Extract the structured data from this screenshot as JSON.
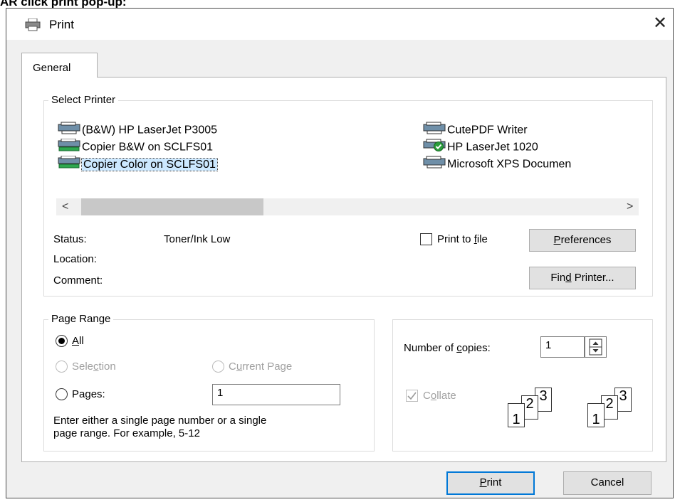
{
  "caption": "AR click print pop-up:",
  "dialog": {
    "title": "Print",
    "tab": "General",
    "select_printer": {
      "label": "Select Printer",
      "printers_left": [
        {
          "name": "(B&W) HP LaserJet P3005",
          "icon": "printer-icon"
        },
        {
          "name": "Copier B&W on SCLFS01",
          "icon": "network-printer-icon"
        },
        {
          "name": "Copier Color on SCLFS01",
          "icon": "network-printer-icon",
          "selected": true
        }
      ],
      "printers_right": [
        {
          "name": "CutePDF Writer",
          "icon": "printer-icon"
        },
        {
          "name": "HP LaserJet 1020",
          "icon": "default-printer-icon"
        },
        {
          "name": "Microsoft XPS Documen",
          "icon": "printer-icon"
        }
      ],
      "scroll_left": "<",
      "scroll_right": ">",
      "status_label": "Status:",
      "status_value": "Toner/Ink Low",
      "location_label": "Location:",
      "comment_label": "Comment:",
      "print_to_file_pre": "Print to ",
      "print_to_file_key": "f",
      "print_to_file_post": "ile",
      "preferences_key": "P",
      "preferences_rest": "references",
      "find_printer_pre": "Fin",
      "find_printer_key": "d",
      "find_printer_post": " Printer..."
    },
    "page_range": {
      "label": "Page Range",
      "all_key": "A",
      "all_rest": "ll",
      "selection_pre": "Sele",
      "selection_key": "c",
      "selection_post": "tion",
      "current_page_pre": "C",
      "current_page_key": "u",
      "current_page_post": "rrent Page",
      "pages_pre": "Pa",
      "pages_key": "g",
      "pages_post": "es:",
      "pages_value": "1",
      "hint_line1": "Enter either a single page number or a single",
      "hint_line2": "page range.  For example, 5-12"
    },
    "copies": {
      "label_pre": "Number of ",
      "label_key": "c",
      "label_post": "opies:",
      "value": "1",
      "collate_pre": "C",
      "collate_key": "o",
      "collate_post": "llate",
      "sheet1": "1",
      "sheet2": "2",
      "sheet3": "3"
    },
    "buttons": {
      "print_key": "P",
      "print_rest": "rint",
      "cancel": "Cancel"
    }
  }
}
